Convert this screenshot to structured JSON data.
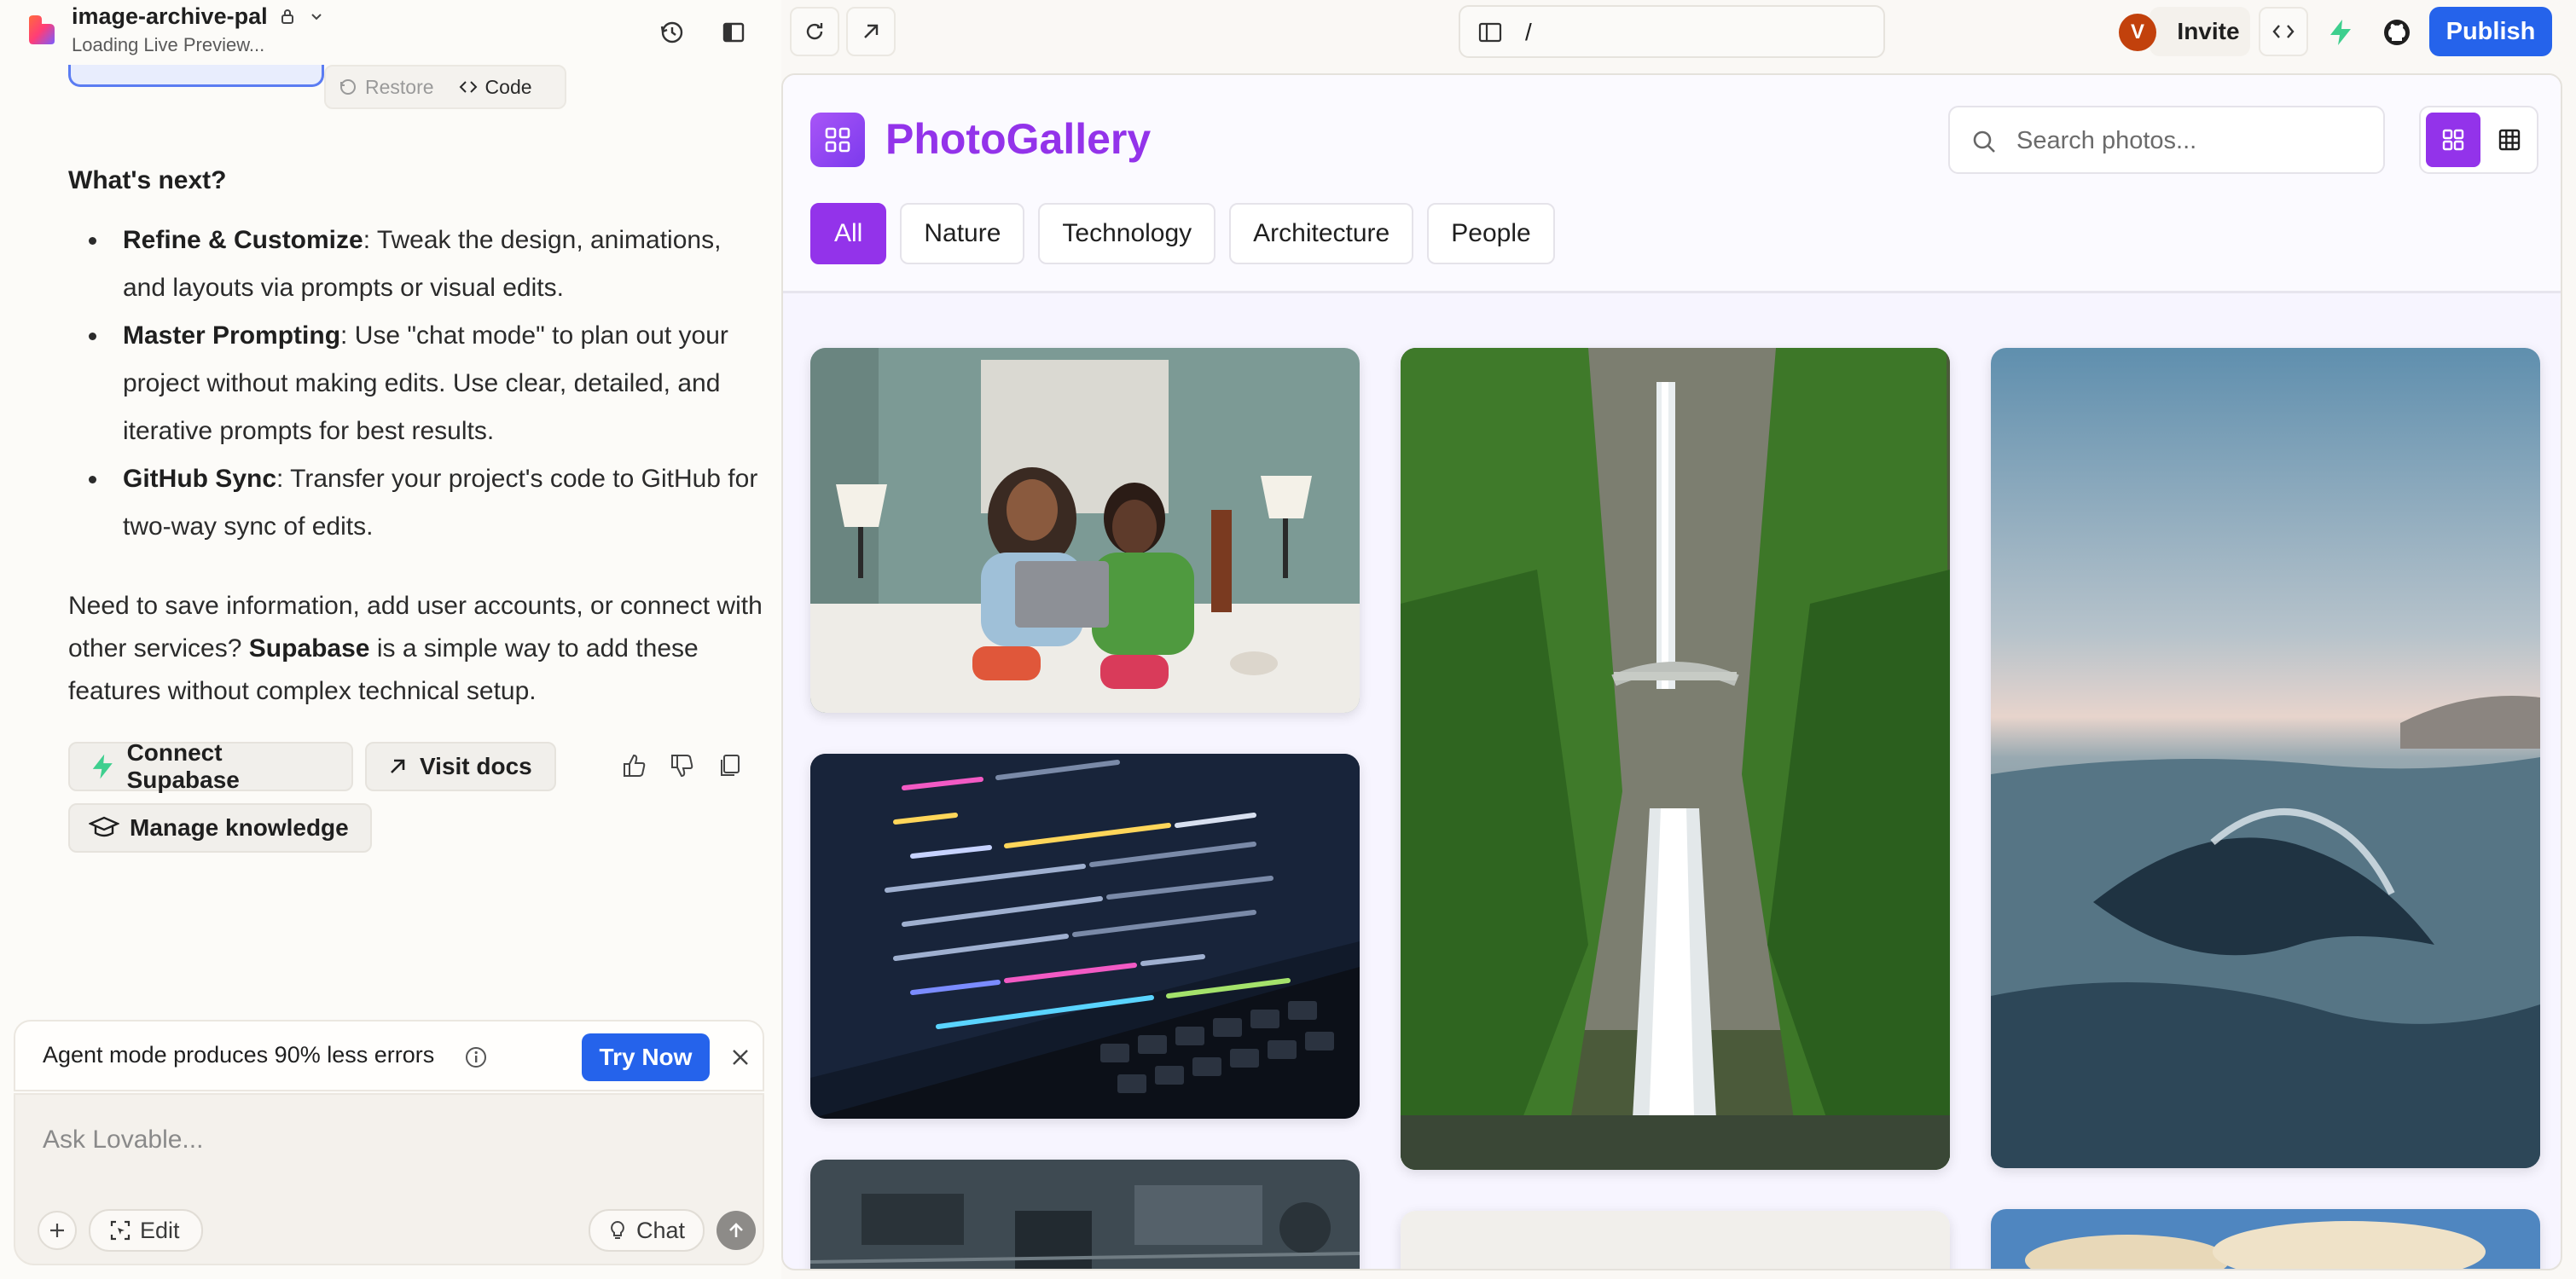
{
  "project": {
    "name": "image-archive-pal",
    "status": "Loading Live Preview..."
  },
  "history_bar": {
    "restore_label": "Restore",
    "code_label": "Code"
  },
  "chat": {
    "heading": "What's next?",
    "bullets": [
      {
        "title": "Refine & Customize",
        "text": ": Tweak the design, animations, and layouts via prompts or visual edits."
      },
      {
        "title": "Master Prompting",
        "text": ": Use \"chat mode\" to plan out your project without making edits. Use clear, detailed, and iterative prompts for best results."
      },
      {
        "title": "GitHub Sync",
        "text": ": Transfer your project's code to GitHub for two-way sync of edits."
      }
    ],
    "paragraph_before": "Need to save information, add user accounts, or connect with other services? ",
    "paragraph_bold": "Supabase",
    "paragraph_after": " is a simple way to add these features without complex technical setup.",
    "actions": {
      "connect_supabase": "Connect Supabase",
      "visit_docs": "Visit docs",
      "manage_knowledge": "Manage knowledge"
    }
  },
  "promo": {
    "text": "Agent mode produces 90% less errors",
    "button": "Try Now"
  },
  "composer": {
    "placeholder": "Ask Lovable...",
    "edit_label": "Edit",
    "chat_label": "Chat"
  },
  "topbar": {
    "url_path": "/",
    "avatar_initial": "V",
    "invite_label": "Invite",
    "publish_label": "Publish"
  },
  "app": {
    "title": "PhotoGallery",
    "search_placeholder": "Search photos...",
    "filters": [
      "All",
      "Nature",
      "Technology",
      "Architecture",
      "People"
    ],
    "active_filter": "All"
  },
  "colors": {
    "accent_purple": "#9333ea",
    "primary_blue": "#2563eb",
    "supabase_green": "#3ecf8e"
  }
}
